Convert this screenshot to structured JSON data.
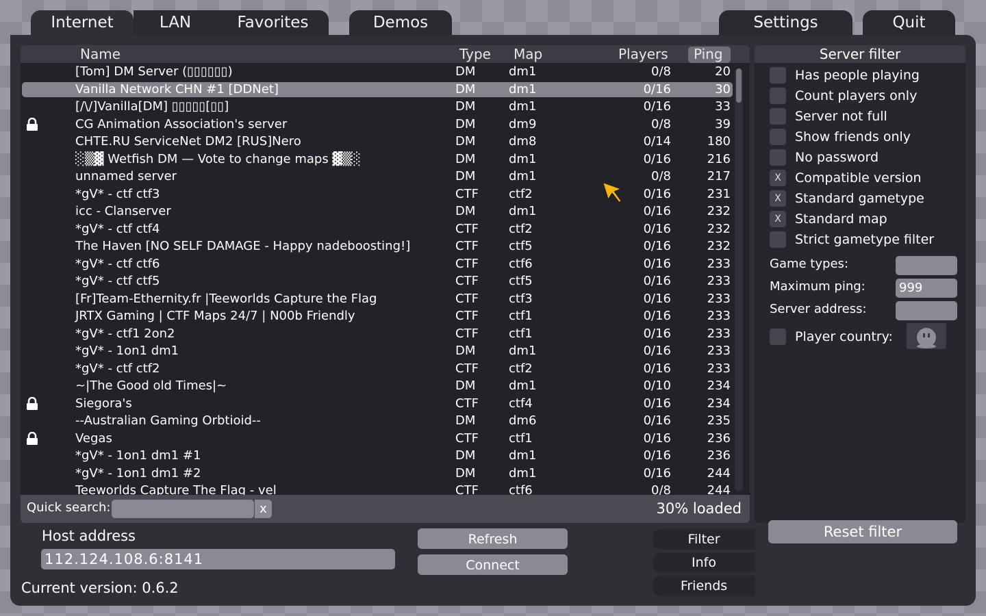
{
  "tabs": {
    "browser": [
      "Internet",
      "LAN",
      "Favorites"
    ],
    "demos": "Demos",
    "settings": "Settings",
    "quit": "Quit"
  },
  "list": {
    "headers": {
      "name": "Name",
      "type": "Type",
      "map": "Map",
      "players": "Players",
      "ping": "Ping"
    },
    "servers": [
      {
        "name": "[Tom] DM Server (▯▯▯▯▯▯)",
        "type": "DM",
        "map": "dm1",
        "players": "0/8",
        "ping": "20",
        "locked": false
      },
      {
        "name": "Vanilla Network CHN #1 [DDNet]",
        "type": "DM",
        "map": "dm1",
        "players": "0/16",
        "ping": "30",
        "locked": false,
        "selected": true
      },
      {
        "name": "[/\\/]Vanilla[DM] ▯▯▯▯▯[▯▯]",
        "type": "DM",
        "map": "dm1",
        "players": "0/16",
        "ping": "33",
        "locked": false
      },
      {
        "name": "CG Animation Association's server",
        "type": "DM",
        "map": "dm9",
        "players": "0/8",
        "ping": "39",
        "locked": true
      },
      {
        "name": "CHTE.RU ServiceNet DM2 [RUS]Nero",
        "type": "DM",
        "map": "dm8",
        "players": "0/14",
        "ping": "180",
        "locked": false
      },
      {
        "name": "░▒▓ Wetfish DM — Vote to change maps ▓▒░",
        "type": "DM",
        "map": "dm1",
        "players": "0/16",
        "ping": "216",
        "locked": false
      },
      {
        "name": "unnamed server",
        "type": "DM",
        "map": "dm1",
        "players": "0/8",
        "ping": "217",
        "locked": false
      },
      {
        "name": "*gV* - ctf ctf3",
        "type": "CTF",
        "map": "ctf2",
        "players": "0/16",
        "ping": "231",
        "locked": false
      },
      {
        "name": "icc - Clanserver",
        "type": "DM",
        "map": "dm1",
        "players": "0/16",
        "ping": "232",
        "locked": false
      },
      {
        "name": "*gV* - ctf ctf4",
        "type": "CTF",
        "map": "ctf2",
        "players": "0/16",
        "ping": "232",
        "locked": false
      },
      {
        "name": "The Haven [NO SELF DAMAGE - Happy nadeboosting!]",
        "type": "CTF",
        "map": "ctf5",
        "players": "0/16",
        "ping": "232",
        "locked": false
      },
      {
        "name": "*gV* - ctf ctf6",
        "type": "CTF",
        "map": "ctf6",
        "players": "0/16",
        "ping": "233",
        "locked": false
      },
      {
        "name": "*gV* - ctf ctf5",
        "type": "CTF",
        "map": "ctf5",
        "players": "0/16",
        "ping": "233",
        "locked": false
      },
      {
        "name": "[Fr]Team-Ethernity.fr |Teeworlds Capture the Flag",
        "type": "CTF",
        "map": "ctf3",
        "players": "0/16",
        "ping": "233",
        "locked": false
      },
      {
        "name": "JRTX Gaming | CTF Maps 24/7 | N00b Friendly",
        "type": "CTF",
        "map": "ctf1",
        "players": "0/16",
        "ping": "233",
        "locked": false
      },
      {
        "name": "*gV* - ctf1 2on2",
        "type": "CTF",
        "map": "ctf1",
        "players": "0/16",
        "ping": "233",
        "locked": false
      },
      {
        "name": "*gV* - 1on1 dm1",
        "type": "DM",
        "map": "dm1",
        "players": "0/16",
        "ping": "233",
        "locked": false
      },
      {
        "name": "*gV* - ctf ctf2",
        "type": "CTF",
        "map": "ctf2",
        "players": "0/16",
        "ping": "233",
        "locked": false
      },
      {
        "name": "~|The Good old Times|~",
        "type": "DM",
        "map": "dm1",
        "players": "0/10",
        "ping": "234",
        "locked": false
      },
      {
        "name": "Siegora's",
        "type": "CTF",
        "map": "ctf4",
        "players": "0/16",
        "ping": "234",
        "locked": true
      },
      {
        "name": "--Australian Gaming Orbtioid--",
        "type": "DM",
        "map": "dm6",
        "players": "0/16",
        "ping": "235",
        "locked": false
      },
      {
        "name": "Vegas",
        "type": "CTF",
        "map": "ctf1",
        "players": "0/16",
        "ping": "236",
        "locked": true
      },
      {
        "name": "*gV* - 1on1 dm1 #1",
        "type": "DM",
        "map": "dm1",
        "players": "0/16",
        "ping": "236",
        "locked": false
      },
      {
        "name": "*gV* - 1on1 dm1 #2",
        "type": "DM",
        "map": "dm1",
        "players": "0/16",
        "ping": "244",
        "locked": false
      },
      {
        "name": "Teeworlds Capture The Flag - vel",
        "type": "CTF",
        "map": "ctf6",
        "players": "0/8",
        "ping": "244",
        "locked": false
      }
    ]
  },
  "search": {
    "label": "Quick search:",
    "value": "",
    "clear": "x",
    "loaded": "30% loaded"
  },
  "filter": {
    "title": "Server filter",
    "options": [
      {
        "label": "Has people playing",
        "checked": false
      },
      {
        "label": "Count players only",
        "checked": false
      },
      {
        "label": "Server not full",
        "checked": false
      },
      {
        "label": "Show friends only",
        "checked": false
      },
      {
        "label": "No password",
        "checked": false
      },
      {
        "label": "Compatible version",
        "checked": true
      },
      {
        "label": "Standard gametype",
        "checked": true
      },
      {
        "label": "Standard map",
        "checked": true
      },
      {
        "label": "Strict gametype filter",
        "checked": false
      }
    ],
    "check_mark": "X",
    "game_types_label": "Game types:",
    "game_types_value": "",
    "max_ping_label": "Maximum ping:",
    "max_ping_value": "999",
    "server_address_label": "Server address:",
    "server_address_value": "",
    "player_country_label": "Player country:",
    "reset": "Reset filter"
  },
  "bottom": {
    "host_label": "Host address",
    "host_value": "112.124.108.6:8141",
    "refresh": "Refresh",
    "connect": "Connect",
    "side_tabs": [
      "Filter",
      "Info",
      "Friends"
    ],
    "version": "Current version: 0.6.2"
  }
}
